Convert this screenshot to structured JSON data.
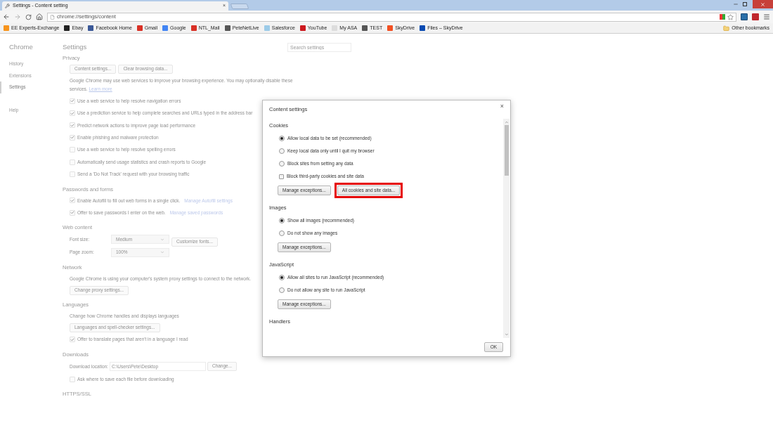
{
  "browser": {
    "tab": {
      "title": "Settings - Content setting",
      "close": "×"
    },
    "url": "chrome://settings/content",
    "bookmarks": [
      {
        "label": "EE Experts-Exchange",
        "color": "#f7941d"
      },
      {
        "label": "Ebay",
        "color": "#222222"
      },
      {
        "label": "Facebook Home",
        "color": "#3b5998"
      },
      {
        "label": "Gmail",
        "color": "#d93025"
      },
      {
        "label": "Google",
        "color": "#4285f4"
      },
      {
        "label": "NTL_Mail",
        "color": "#d93025"
      },
      {
        "label": "PeteNetLive",
        "color": "#555555"
      },
      {
        "label": "Salesforce",
        "color": "#9ccbe8"
      },
      {
        "label": "YouTube",
        "color": "#cc181e"
      },
      {
        "label": "My ASA",
        "color": "#dddddd"
      },
      {
        "label": "TEST",
        "color": "#555555"
      },
      {
        "label": "SkyDrive",
        "color": "#f25022"
      },
      {
        "label": "Files – SkyDrive",
        "color": "#094ab2"
      }
    ],
    "other_bookmarks": "Other bookmarks"
  },
  "sidebar": {
    "title": "Chrome",
    "items": [
      {
        "label": "History",
        "selected": false
      },
      {
        "label": "Extensions",
        "selected": false
      },
      {
        "label": "Settings",
        "selected": true
      }
    ],
    "extra_items": [
      {
        "label": "Help",
        "selected": false
      }
    ]
  },
  "page": {
    "title": "Settings",
    "search": {
      "placeholder": "Search settings"
    },
    "sections": [
      {
        "title": "Privacy",
        "items": [
          {
            "kind": "buttons",
            "buttons": [
              "Content settings...",
              "Clear browsing data..."
            ]
          },
          {
            "kind": "text",
            "text": "Google Chrome may use web services to improve your browsing experience. You may optionally disable these services.",
            "link": "Learn more"
          },
          {
            "kind": "checkbox",
            "label": "Use a web service to help resolve navigation errors",
            "checked": true
          },
          {
            "kind": "checkbox",
            "label": "Use a prediction service to help complete searches and URLs typed in the address bar",
            "checked": true
          },
          {
            "kind": "checkbox",
            "label": "Predict network actions to improve page load performance",
            "checked": true
          },
          {
            "kind": "checkbox",
            "label": "Enable phishing and malware protection",
            "checked": true
          },
          {
            "kind": "checkbox",
            "label": "Use a web service to help resolve spelling errors",
            "checked": false
          },
          {
            "kind": "checkbox",
            "label": "Automatically send usage statistics and crash reports to Google",
            "checked": false
          },
          {
            "kind": "checkbox",
            "label": "Send a 'Do Not Track' request with your browsing traffic",
            "checked": false
          }
        ]
      },
      {
        "title": "Passwords and forms",
        "items": [
          {
            "kind": "checkbox",
            "label": "Enable Autofill to fill out web forms in a single click.",
            "checked": true,
            "link": "Manage Autofill settings"
          },
          {
            "kind": "checkbox",
            "label": "Offer to save passwords I enter on the web.",
            "checked": true,
            "link": "Manage saved passwords"
          }
        ]
      },
      {
        "title": "Web content",
        "items": [
          {
            "kind": "select",
            "label": "Font size:",
            "value": "Medium",
            "button": "Customize fonts..."
          },
          {
            "kind": "select",
            "label": "Page zoom:",
            "value": "100%"
          }
        ]
      },
      {
        "title": "Network",
        "items": [
          {
            "kind": "text",
            "text": "Google Chrome is using your computer's system proxy settings to connect to the network."
          },
          {
            "kind": "buttons",
            "buttons": [
              "Change proxy settings..."
            ]
          }
        ]
      },
      {
        "title": "Languages",
        "items": [
          {
            "kind": "text",
            "text": "Change how Chrome handles and displays languages"
          },
          {
            "kind": "buttons",
            "buttons": [
              "Languages and spell-checker settings..."
            ]
          },
          {
            "kind": "checkbox",
            "label": "Offer to translate pages that aren't in a language I read",
            "checked": true
          }
        ]
      },
      {
        "title": "Downloads",
        "items": [
          {
            "kind": "field",
            "label": "Download location:",
            "value": "C:\\Users\\Pete\\Desktop",
            "button": "Change..."
          },
          {
            "kind": "checkbox",
            "label": "Ask where to save each file before downloading",
            "checked": false
          }
        ]
      },
      {
        "title": "HTTPS/SSL"
      }
    ]
  },
  "dialog": {
    "title": "Content settings",
    "close": "×",
    "sections": [
      {
        "title": "Cookies",
        "options": [
          {
            "kind": "radio",
            "label": "Allow local data to be set (recommended)",
            "selected": true
          },
          {
            "kind": "radio",
            "label": "Keep local data only until I quit my browser",
            "selected": false
          },
          {
            "kind": "radio",
            "label": "Block sites from setting any data",
            "selected": false
          },
          {
            "kind": "checkbox",
            "label": "Block third-party cookies and site data",
            "checked": false
          }
        ],
        "buttons": [
          {
            "label": "Manage exceptions...",
            "highlighted": false
          },
          {
            "label": "All cookies and site data...",
            "highlighted": true
          }
        ]
      },
      {
        "title": "Images",
        "options": [
          {
            "kind": "radio",
            "label": "Show all images (recommended)",
            "selected": true
          },
          {
            "kind": "radio",
            "label": "Do not show any images",
            "selected": false
          }
        ],
        "buttons": [
          {
            "label": "Manage exceptions...",
            "highlighted": false
          }
        ]
      },
      {
        "title": "JavaScript",
        "options": [
          {
            "kind": "radio",
            "label": "Allow all sites to run JavaScript (recommended)",
            "selected": true
          },
          {
            "kind": "radio",
            "label": "Do not allow any site to run JavaScript",
            "selected": false
          }
        ],
        "buttons": [
          {
            "label": "Manage exceptions...",
            "highlighted": false
          }
        ]
      },
      {
        "title": "Handlers"
      }
    ],
    "ok": "OK"
  }
}
